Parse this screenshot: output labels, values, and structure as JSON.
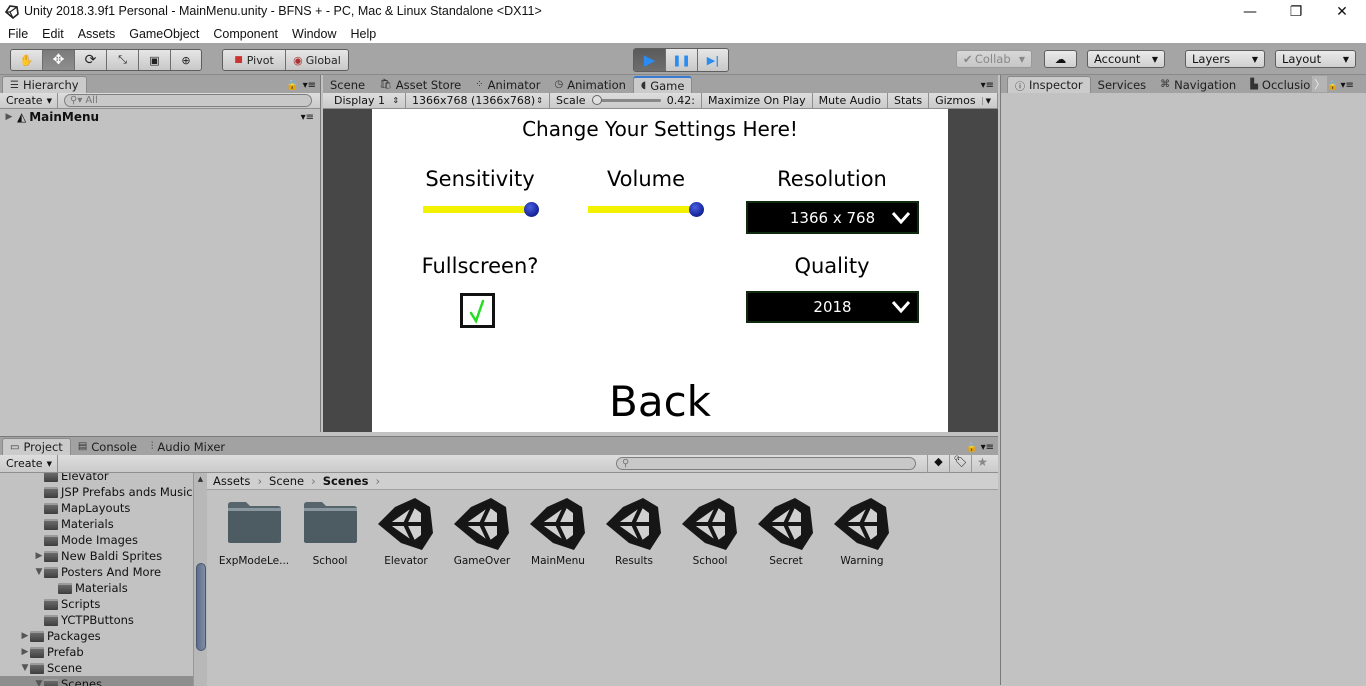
{
  "window": {
    "title": "Unity 2018.3.9f1 Personal - MainMenu.unity - BFNS + - PC, Mac & Linux Standalone <DX11>",
    "controls": {
      "minimize": "—",
      "restore": "❐",
      "close": "✕"
    }
  },
  "menubar": [
    "File",
    "Edit",
    "Assets",
    "GameObject",
    "Component",
    "Window",
    "Help"
  ],
  "toolbar": {
    "tools": [
      "hand-tool",
      "move-tool",
      "rotate-tool",
      "scale-tool",
      "rect-tool",
      "transform-tool"
    ],
    "pivot_label": "Pivot",
    "global_label": "Global",
    "play": "▶",
    "pause": "❚❚",
    "step": "▶|",
    "collab_label": "Collab",
    "account_label": "Account",
    "layers_label": "Layers",
    "layout_label": "Layout"
  },
  "hierarchy": {
    "tab_label": "Hierarchy",
    "create_label": "Create",
    "search_placeholder": "All",
    "root_item": "MainMenu"
  },
  "center_tabs": [
    "Scene",
    "Asset Store",
    "Animator",
    "Animation",
    "Game"
  ],
  "game_toolbar": {
    "display": "Display 1",
    "resolution": "1366x768 (1366x768)",
    "scale_label": "Scale",
    "scale_value": "0.42:",
    "scale_fraction": 0.0,
    "maximize_on_play": "Maximize On Play",
    "mute_audio": "Mute Audio",
    "stats": "Stats",
    "gizmos": "Gizmos"
  },
  "game_ui": {
    "heading": "Change Your Settings Here!",
    "sensitivity_label": "Sensitivity",
    "sensitivity_value": 1.0,
    "volume_label": "Volume",
    "volume_value": 1.0,
    "resolution_label": "Resolution",
    "resolution_value": "1366 x 768",
    "fullscreen_label": "Fullscreen?",
    "fullscreen_checked": true,
    "quality_label": "Quality",
    "quality_value": "2018",
    "back_label": "Back",
    "colors": {
      "slider_fill": "#f2f200",
      "knob": "#1a2aa0",
      "check": "#22dd22",
      "dropdown_bg": "#000000"
    }
  },
  "right_tabs": [
    "Inspector",
    "Services",
    "Navigation",
    "Occlusio"
  ],
  "bottom_tabs": [
    "Project",
    "Console",
    "Audio Mixer"
  ],
  "project": {
    "create_label": "Create",
    "breadcrumb": [
      "Assets",
      "Scene",
      "Scenes"
    ],
    "tree": [
      {
        "label": "Elevator",
        "indent": 2,
        "arrow": ""
      },
      {
        "label": "JSP Prefabs ands Music",
        "indent": 2,
        "arrow": ""
      },
      {
        "label": "MapLayouts",
        "indent": 2,
        "arrow": ""
      },
      {
        "label": "Materials",
        "indent": 2,
        "arrow": ""
      },
      {
        "label": "Mode Images",
        "indent": 2,
        "arrow": ""
      },
      {
        "label": "New Baldi Sprites",
        "indent": 2,
        "arrow": "▶"
      },
      {
        "label": "Posters And More",
        "indent": 2,
        "arrow": "▼"
      },
      {
        "label": "Materials",
        "indent": 3,
        "arrow": ""
      },
      {
        "label": "Scripts",
        "indent": 2,
        "arrow": ""
      },
      {
        "label": "YCTPButtons",
        "indent": 2,
        "arrow": ""
      },
      {
        "label": "Packages",
        "indent": 1,
        "arrow": "▶"
      },
      {
        "label": "Prefab",
        "indent": 1,
        "arrow": "▶"
      },
      {
        "label": "Scene",
        "indent": 1,
        "arrow": "▼"
      },
      {
        "label": "Scenes",
        "indent": 2,
        "arrow": "▼"
      }
    ],
    "assets": [
      {
        "name": "ExpModeLe...",
        "type": "folder"
      },
      {
        "name": "School",
        "type": "folder"
      },
      {
        "name": "Elevator",
        "type": "scene"
      },
      {
        "name": "GameOver",
        "type": "scene"
      },
      {
        "name": "MainMenu",
        "type": "scene"
      },
      {
        "name": "Results",
        "type": "scene"
      },
      {
        "name": "School",
        "type": "scene"
      },
      {
        "name": "Secret",
        "type": "scene"
      },
      {
        "name": "Warning",
        "type": "scene"
      }
    ]
  }
}
